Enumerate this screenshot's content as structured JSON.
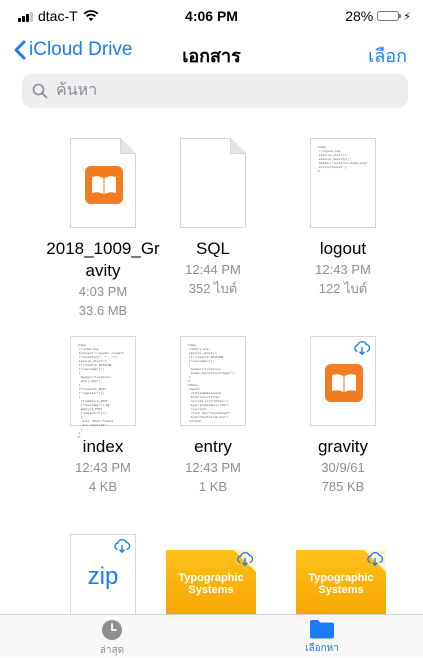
{
  "status": {
    "carrier": "dtac-T",
    "time": "4:06 PM",
    "battery": "28%",
    "battery_level": 0.28
  },
  "nav": {
    "back_label": "iCloud Drive",
    "title": "เอกสาร",
    "select_label": "เลือก"
  },
  "search": {
    "placeholder": "ค้นหา",
    "icon": "search-icon"
  },
  "files": [
    {
      "name_line1": "2018_1009_Gr",
      "name_line2": "avity",
      "date": "4:03 PM",
      "size": "33.6 MB",
      "kind": "book"
    },
    {
      "name_line1": "SQL",
      "date": "12:44 PM",
      "size": "352 ไบต์",
      "kind": "blank"
    },
    {
      "name_line1": "logout",
      "date": "12:43 PM",
      "size": "122 ไบต์",
      "kind": "code"
    },
    {
      "name_line1": "index",
      "date": "12:43 PM",
      "size": "4 KB",
      "kind": "code"
    },
    {
      "name_line1": "entry",
      "date": "12:43 PM",
      "size": "1 KB",
      "kind": "code"
    },
    {
      "name_line1": "gravity",
      "date": "30/9/61",
      "size": "785 KB",
      "kind": "book-cloud"
    }
  ],
  "bottom_items": [
    {
      "label": "zip",
      "kind": "zip-cloud"
    },
    {
      "label": "Typographic Systems",
      "kind": "book-cover-cloud"
    },
    {
      "label": "Typographic Systems",
      "kind": "book-cover-cloud"
    }
  ],
  "tabs": [
    {
      "label": "ล่าสุด",
      "icon": "clock-icon",
      "active": false
    },
    {
      "label": "เลือกหา",
      "icon": "folder-icon",
      "active": true
    }
  ],
  "colors": {
    "accent": "#1b7cf7",
    "book": "#f37c20",
    "cover": "#ffc21a",
    "muted": "#8e8e93"
  }
}
